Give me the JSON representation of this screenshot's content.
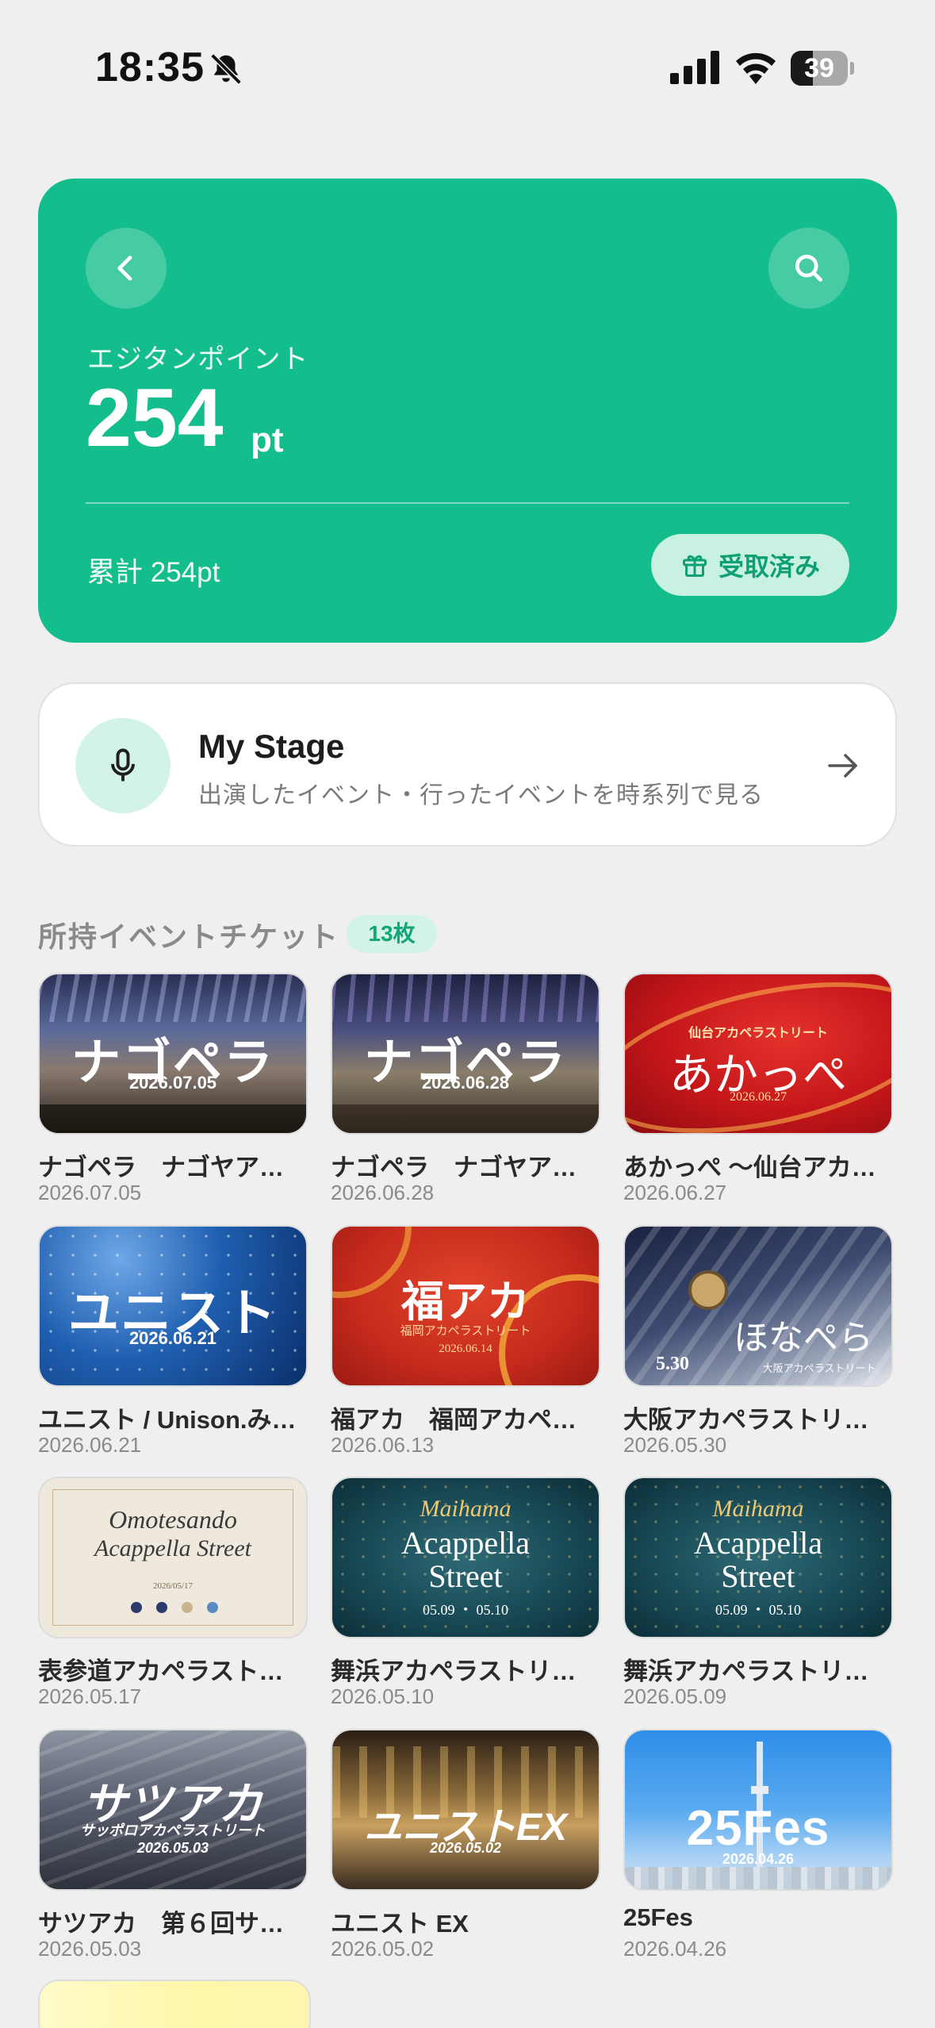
{
  "status_bar": {
    "time": "18:35",
    "battery": "39",
    "battery_level": 0.39
  },
  "points_card": {
    "label": "エジタンポイント",
    "value": "254",
    "unit": "pt",
    "total": "累計 254pt",
    "received_label": "受取済み",
    "color": "#13bd8c"
  },
  "my_stage": {
    "title": "My Stage",
    "subtitle": "出演したイベント・行ったイベントを時系列で見る"
  },
  "tickets_section": {
    "title": "所持イベントチケット",
    "count": "13枚"
  },
  "tickets": [
    {
      "title": "ナゴペラ　ナゴヤアカ…",
      "date": "2026.07.05",
      "art_text": "ナゴペラ",
      "art_sub": "2026.07.05"
    },
    {
      "title": "ナゴペラ　ナゴヤアカ…",
      "date": "2026.06.28",
      "art_text": "ナゴペラ",
      "art_sub": "2026.06.28"
    },
    {
      "title": "あかっぺ ～仙台アカ…",
      "date": "2026.06.27",
      "art_text": "あかっぺ",
      "art_sub": "2026.06.27",
      "art_top": "仙台アカペラストリート"
    },
    {
      "title": "ユニスト / Unison.み…",
      "date": "2026.06.21",
      "art_text": "ユニスト",
      "art_sub": "2026.06.21"
    },
    {
      "title": "福アカ　福岡アカペラ…",
      "date": "2026.06.13",
      "art_text": "福アカ",
      "art_sub": "2026.06.14",
      "art_mid": "福岡アカペラストリート"
    },
    {
      "title": "大阪アカペラストリート",
      "date": "2026.05.30",
      "art_text": "ほなぺら",
      "art_sub": "5.30",
      "art_mid": "大阪アカペラストリート"
    },
    {
      "title": "表参道アカペラストリ…",
      "date": "2026.05.17",
      "art_text": "Omotesando",
      "art_text2": "Acappella Street",
      "art_sub": "2026/05/17"
    },
    {
      "title": "舞浜アカペラストリート",
      "date": "2026.05.10",
      "art_text": "Maihama",
      "art_text2": "Acappella",
      "art_text3": "Street",
      "art_sub": "05.09 ・ 05.10"
    },
    {
      "title": "舞浜アカペラストリート",
      "date": "2026.05.09",
      "art_text": "Maihama",
      "art_text2": "Acappella",
      "art_text3": "Street",
      "art_sub": "05.09 ・ 05.10"
    },
    {
      "title": "サツアカ　第６回サッ…",
      "date": "2026.05.03",
      "art_text": "サツアカ",
      "art_text2": "サッポロアカペラストリート",
      "art_sub": "2026.05.03"
    },
    {
      "title": "ユニスト EX",
      "date": "2026.05.02",
      "art_text": "ユニストEX",
      "art_sub": "2026.05.02"
    },
    {
      "title": "25Fes",
      "date": "2026.04.26",
      "art_text": "25Fes",
      "art_sub": "2026.04.26"
    }
  ]
}
